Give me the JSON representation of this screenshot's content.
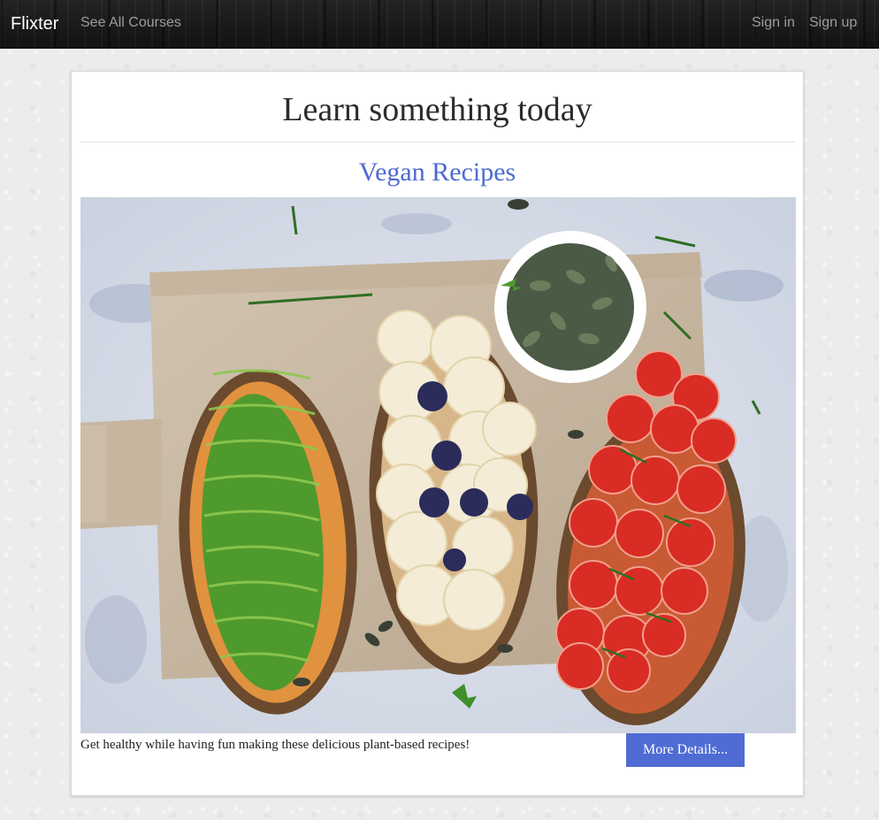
{
  "navbar": {
    "brand": "Flixter",
    "links": {
      "courses": "See All Courses",
      "sign_in": "Sign in",
      "sign_up": "Sign up"
    }
  },
  "main": {
    "title": "Learn something today",
    "course": {
      "title": "Vegan Recipes",
      "description": "Get healthy while having fun making these delicious plant-based recipes!",
      "button_label": "More Details..."
    }
  },
  "colors": {
    "link_blue": "#4e6ad0",
    "button_blue": "#4f6bd4",
    "navbar_dark": "#1b1b1b"
  }
}
